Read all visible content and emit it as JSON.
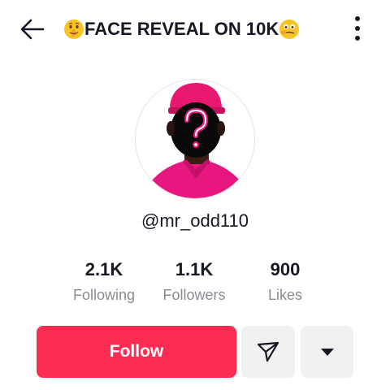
{
  "header": {
    "title": "FACE REVEAL ON 10K",
    "leading_emoji": "shushing-face-emoji",
    "trailing_emoji": "face-with-open-eyes-hand-over-mouth-emoji",
    "back_icon": "arrow-left-icon",
    "more_icon": "vertical-dots-icon"
  },
  "profile": {
    "username": "@mr_odd110",
    "avatar_description_icon": "question-mark-silhouette"
  },
  "stats": [
    {
      "value": "2.1K",
      "label": "Following"
    },
    {
      "value": "1.1K",
      "label": "Followers"
    },
    {
      "value": "900",
      "label": "Likes"
    }
  ],
  "actions": {
    "follow_label": "Follow",
    "message_icon": "paper-plane-icon",
    "more_icon": "caret-down-icon"
  },
  "colors": {
    "accent": "#fe2c55",
    "text": "#161823",
    "muted": "#8a8b91",
    "button_bg": "#f1f1f2"
  }
}
